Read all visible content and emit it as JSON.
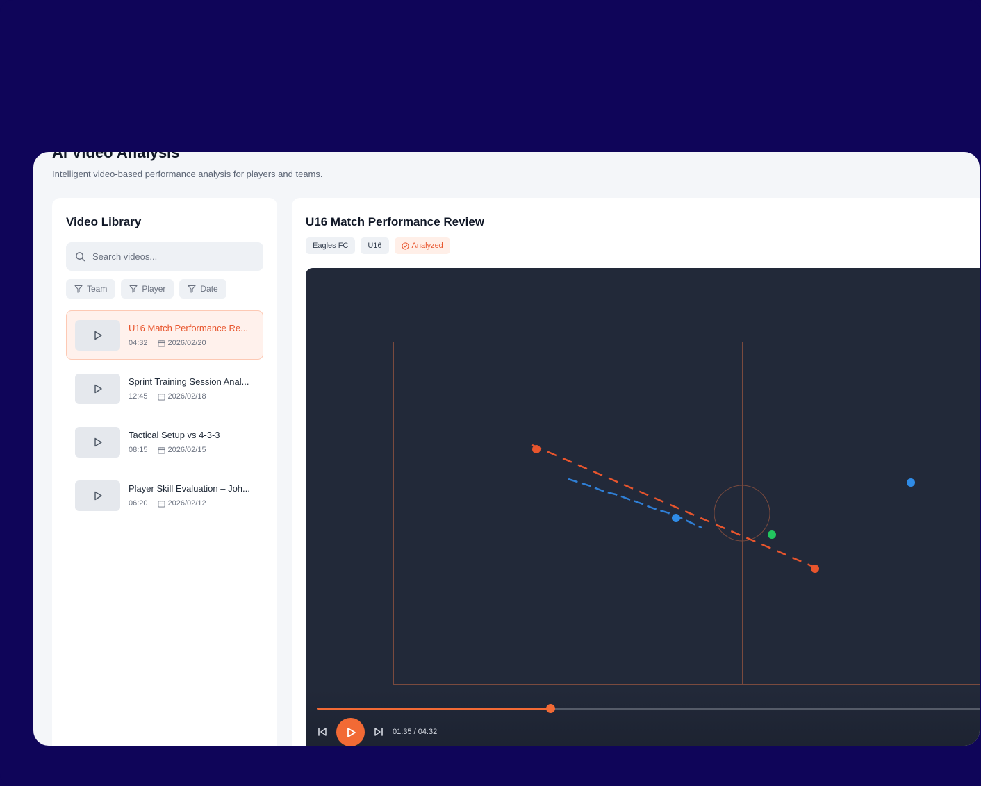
{
  "page": {
    "title": "AI Video Analysis",
    "subtitle": "Intelligent video-based performance analysis for players and teams."
  },
  "library": {
    "title": "Video Library",
    "search_placeholder": "Search videos...",
    "filters": [
      "Team",
      "Player",
      "Date"
    ],
    "videos": [
      {
        "title": "U16 Match Performance Re...",
        "duration": "04:32",
        "date": "2026/02/20",
        "active": true
      },
      {
        "title": "Sprint Training Session Anal...",
        "duration": "12:45",
        "date": "2026/02/18",
        "active": false
      },
      {
        "title": "Tactical Setup vs 4-3-3",
        "duration": "08:15",
        "date": "2026/02/15",
        "active": false
      },
      {
        "title": "Player Skill Evaluation – Joh...",
        "duration": "06:20",
        "date": "2026/02/12",
        "active": false
      }
    ]
  },
  "main": {
    "title": "U16 Match Performance Review",
    "tags": [
      "Eagles FC",
      "U16"
    ],
    "status": "Analyzed",
    "time_display": "01:35 / 04:32",
    "progress": 0.349
  },
  "colors": {
    "accent": "#f26a35",
    "player_blue": "#2f8be6",
    "player_green": "#22c55e",
    "player_orange": "#e8552d",
    "background": "#0f0559"
  },
  "icons": [
    "search-icon",
    "filter-icon",
    "play-icon",
    "calendar-icon",
    "check-circle-icon",
    "skip-back-icon",
    "skip-forward-icon"
  ]
}
